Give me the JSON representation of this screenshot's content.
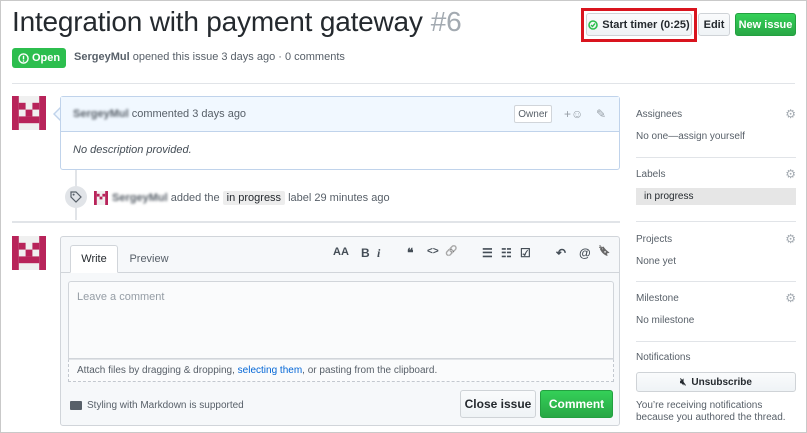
{
  "issue": {
    "title": "Integration with payment gateway",
    "number": "#6",
    "state": "Open",
    "author": "SergeyMul",
    "meta_text": "opened this issue 3 days ago · 0 comments"
  },
  "header_buttons": {
    "timer": "Start timer (0:25)",
    "edit": "Edit",
    "new_issue": "New issue"
  },
  "comment": {
    "author": "SergeyMul",
    "action": "commented 3 days ago",
    "badge": "Owner",
    "body": "No description provided."
  },
  "event": {
    "actor": "SergeyMul",
    "pre": "added the",
    "label": "in progress",
    "post": "label 29 minutes ago"
  },
  "composer": {
    "tab_write": "Write",
    "tab_preview": "Preview",
    "placeholder": "Leave a comment",
    "attach_pre": "Attach files by dragging & dropping,",
    "attach_link": "selecting them",
    "attach_post": ", or pasting from the clipboard.",
    "markdown_note": "Styling with Markdown is supported",
    "close_button": "Close issue",
    "comment_button": "Comment",
    "toolbar": {
      "heading": "AA",
      "bold": "B",
      "italic": "i",
      "quote": "❝",
      "code": "<>",
      "link": "🔗",
      "ul": "☰",
      "ol": "☷",
      "tasks": "☑",
      "reply": "↶",
      "mention": "@",
      "bookmark": "🔖"
    }
  },
  "sidebar": {
    "assignees": {
      "heading": "Assignees",
      "value": "No one—assign yourself"
    },
    "labels": {
      "heading": "Labels",
      "value": "in progress"
    },
    "projects": {
      "heading": "Projects",
      "value": "None yet"
    },
    "milestone": {
      "heading": "Milestone",
      "value": "No milestone"
    },
    "notifications": {
      "heading": "Notifications",
      "button": "Unsubscribe",
      "note": "You’re receiving notifications because you authored the thread."
    }
  },
  "colors": {
    "green": "#2cbe4e",
    "highlight": "#d9141e",
    "link": "#0366d6",
    "avatar": "#b8245a"
  }
}
